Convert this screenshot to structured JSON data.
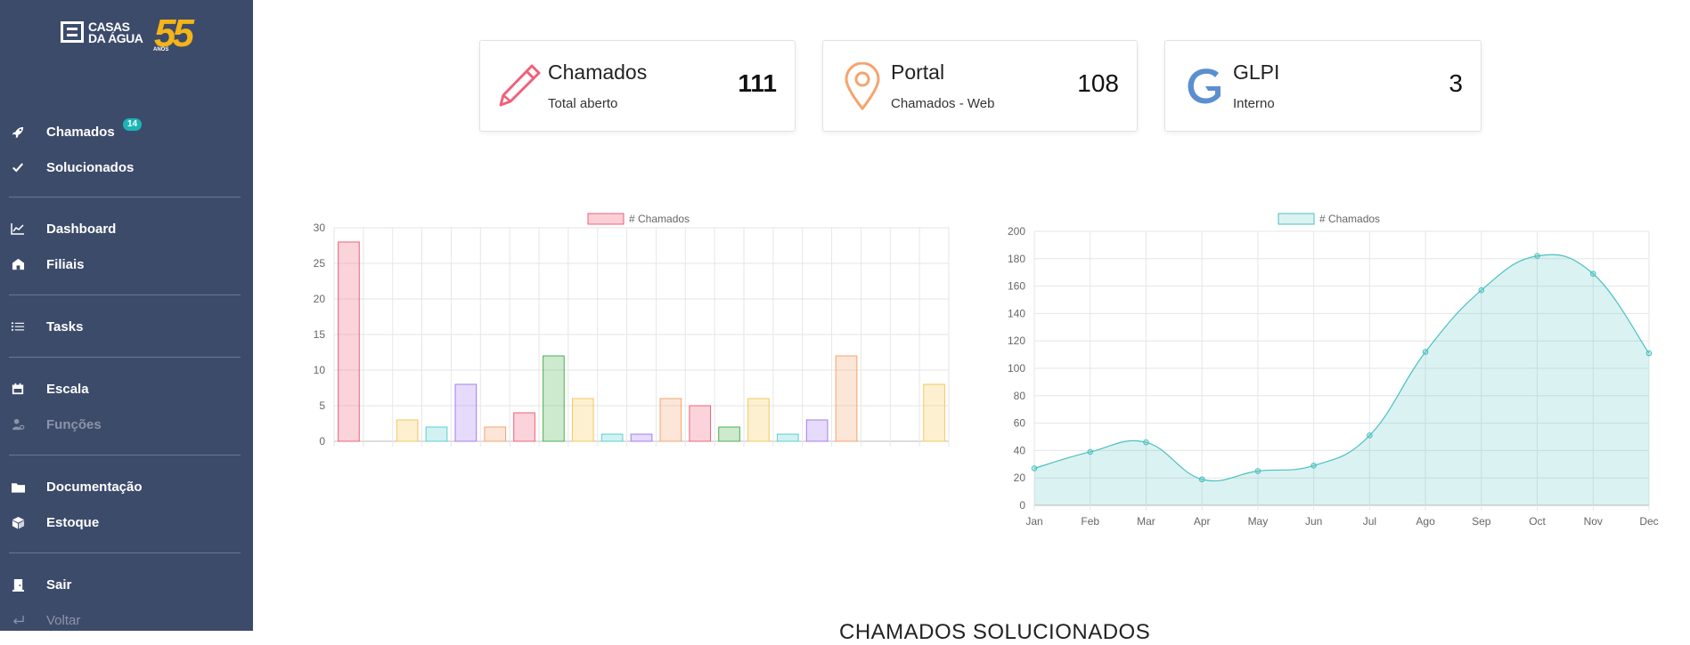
{
  "sidebar": {
    "logo": {
      "line1": "CASAS",
      "line2": "DA ÁGUA",
      "number": "55",
      "anos": "ANOS"
    },
    "items": [
      {
        "label": "Chamados",
        "icon": "rocket-icon",
        "badge": "14"
      },
      {
        "label": "Solucionados",
        "icon": "check-icon"
      },
      {
        "label": "Dashboard",
        "icon": "line-chart-icon"
      },
      {
        "label": "Filiais",
        "icon": "building-icon"
      },
      {
        "label": "Tasks",
        "icon": "list-icon"
      },
      {
        "label": "Escala",
        "icon": "calendar-icon"
      },
      {
        "label": "Funções",
        "icon": "user-gear-icon"
      },
      {
        "label": "Documentação",
        "icon": "folder-icon"
      },
      {
        "label": "Estoque",
        "icon": "box-icon"
      },
      {
        "label": "Sair",
        "icon": "door-icon"
      },
      {
        "label": "Voltar",
        "icon": "return-arrow-icon"
      }
    ]
  },
  "cards": [
    {
      "title": "Chamados",
      "subtitle": "Total aberto",
      "value": "111",
      "icon": "pencil-icon",
      "color": "#f0607a"
    },
    {
      "title": "Portal",
      "subtitle": "Chamados - Web",
      "value": "108",
      "icon": "map-pin-icon",
      "color": "#f5a46e"
    },
    {
      "title": "GLPI",
      "subtitle": "Interno",
      "value": "3",
      "icon": "glpi-logo-icon",
      "color": "#5b8fd0"
    }
  ],
  "chart_data": [
    {
      "type": "bar",
      "legend": "# Chamados",
      "legend_placement": "top",
      "values": [
        28,
        0,
        3,
        2,
        8,
        2,
        4,
        12,
        6,
        1,
        1,
        6,
        5,
        2,
        6,
        1,
        3,
        12,
        0,
        0,
        8
      ],
      "ylim": [
        0,
        30
      ],
      "yticks": [
        0,
        5,
        10,
        15,
        20,
        25,
        30
      ],
      "grid": true,
      "colors": [
        "#f0607a",
        "#f5a46e",
        "#f5c85a",
        "#5ccfcf",
        "#a57cf0",
        "#f5a46e",
        "#f0607a",
        "#4cb050",
        "#f5c85a",
        "#5ccfcf",
        "#a57cf0",
        "#f5a46e",
        "#f0607a",
        "#4cb050",
        "#f5c85a",
        "#5ccfcf",
        "#a57cf0",
        "#f5a46e",
        "#f0607a",
        "#4cb050",
        "#f5c85a"
      ]
    },
    {
      "type": "area",
      "legend": "# Chamados",
      "legend_placement": "top",
      "categories": [
        "Jan",
        "Feb",
        "Mar",
        "Apr",
        "May",
        "Jun",
        "Jul",
        "Ago",
        "Sep",
        "Oct",
        "Nov",
        "Dec"
      ],
      "values": [
        27,
        39,
        46,
        19,
        25,
        29,
        51,
        112,
        157,
        182,
        169,
        111
      ],
      "ylim": [
        0,
        200
      ],
      "yticks": [
        0,
        20,
        40,
        60,
        80,
        100,
        120,
        140,
        160,
        180,
        200
      ],
      "grid": true,
      "color": "#4bc0c0"
    }
  ],
  "footer": {
    "title": "CHAMADOS SOLUCIONADOS"
  }
}
